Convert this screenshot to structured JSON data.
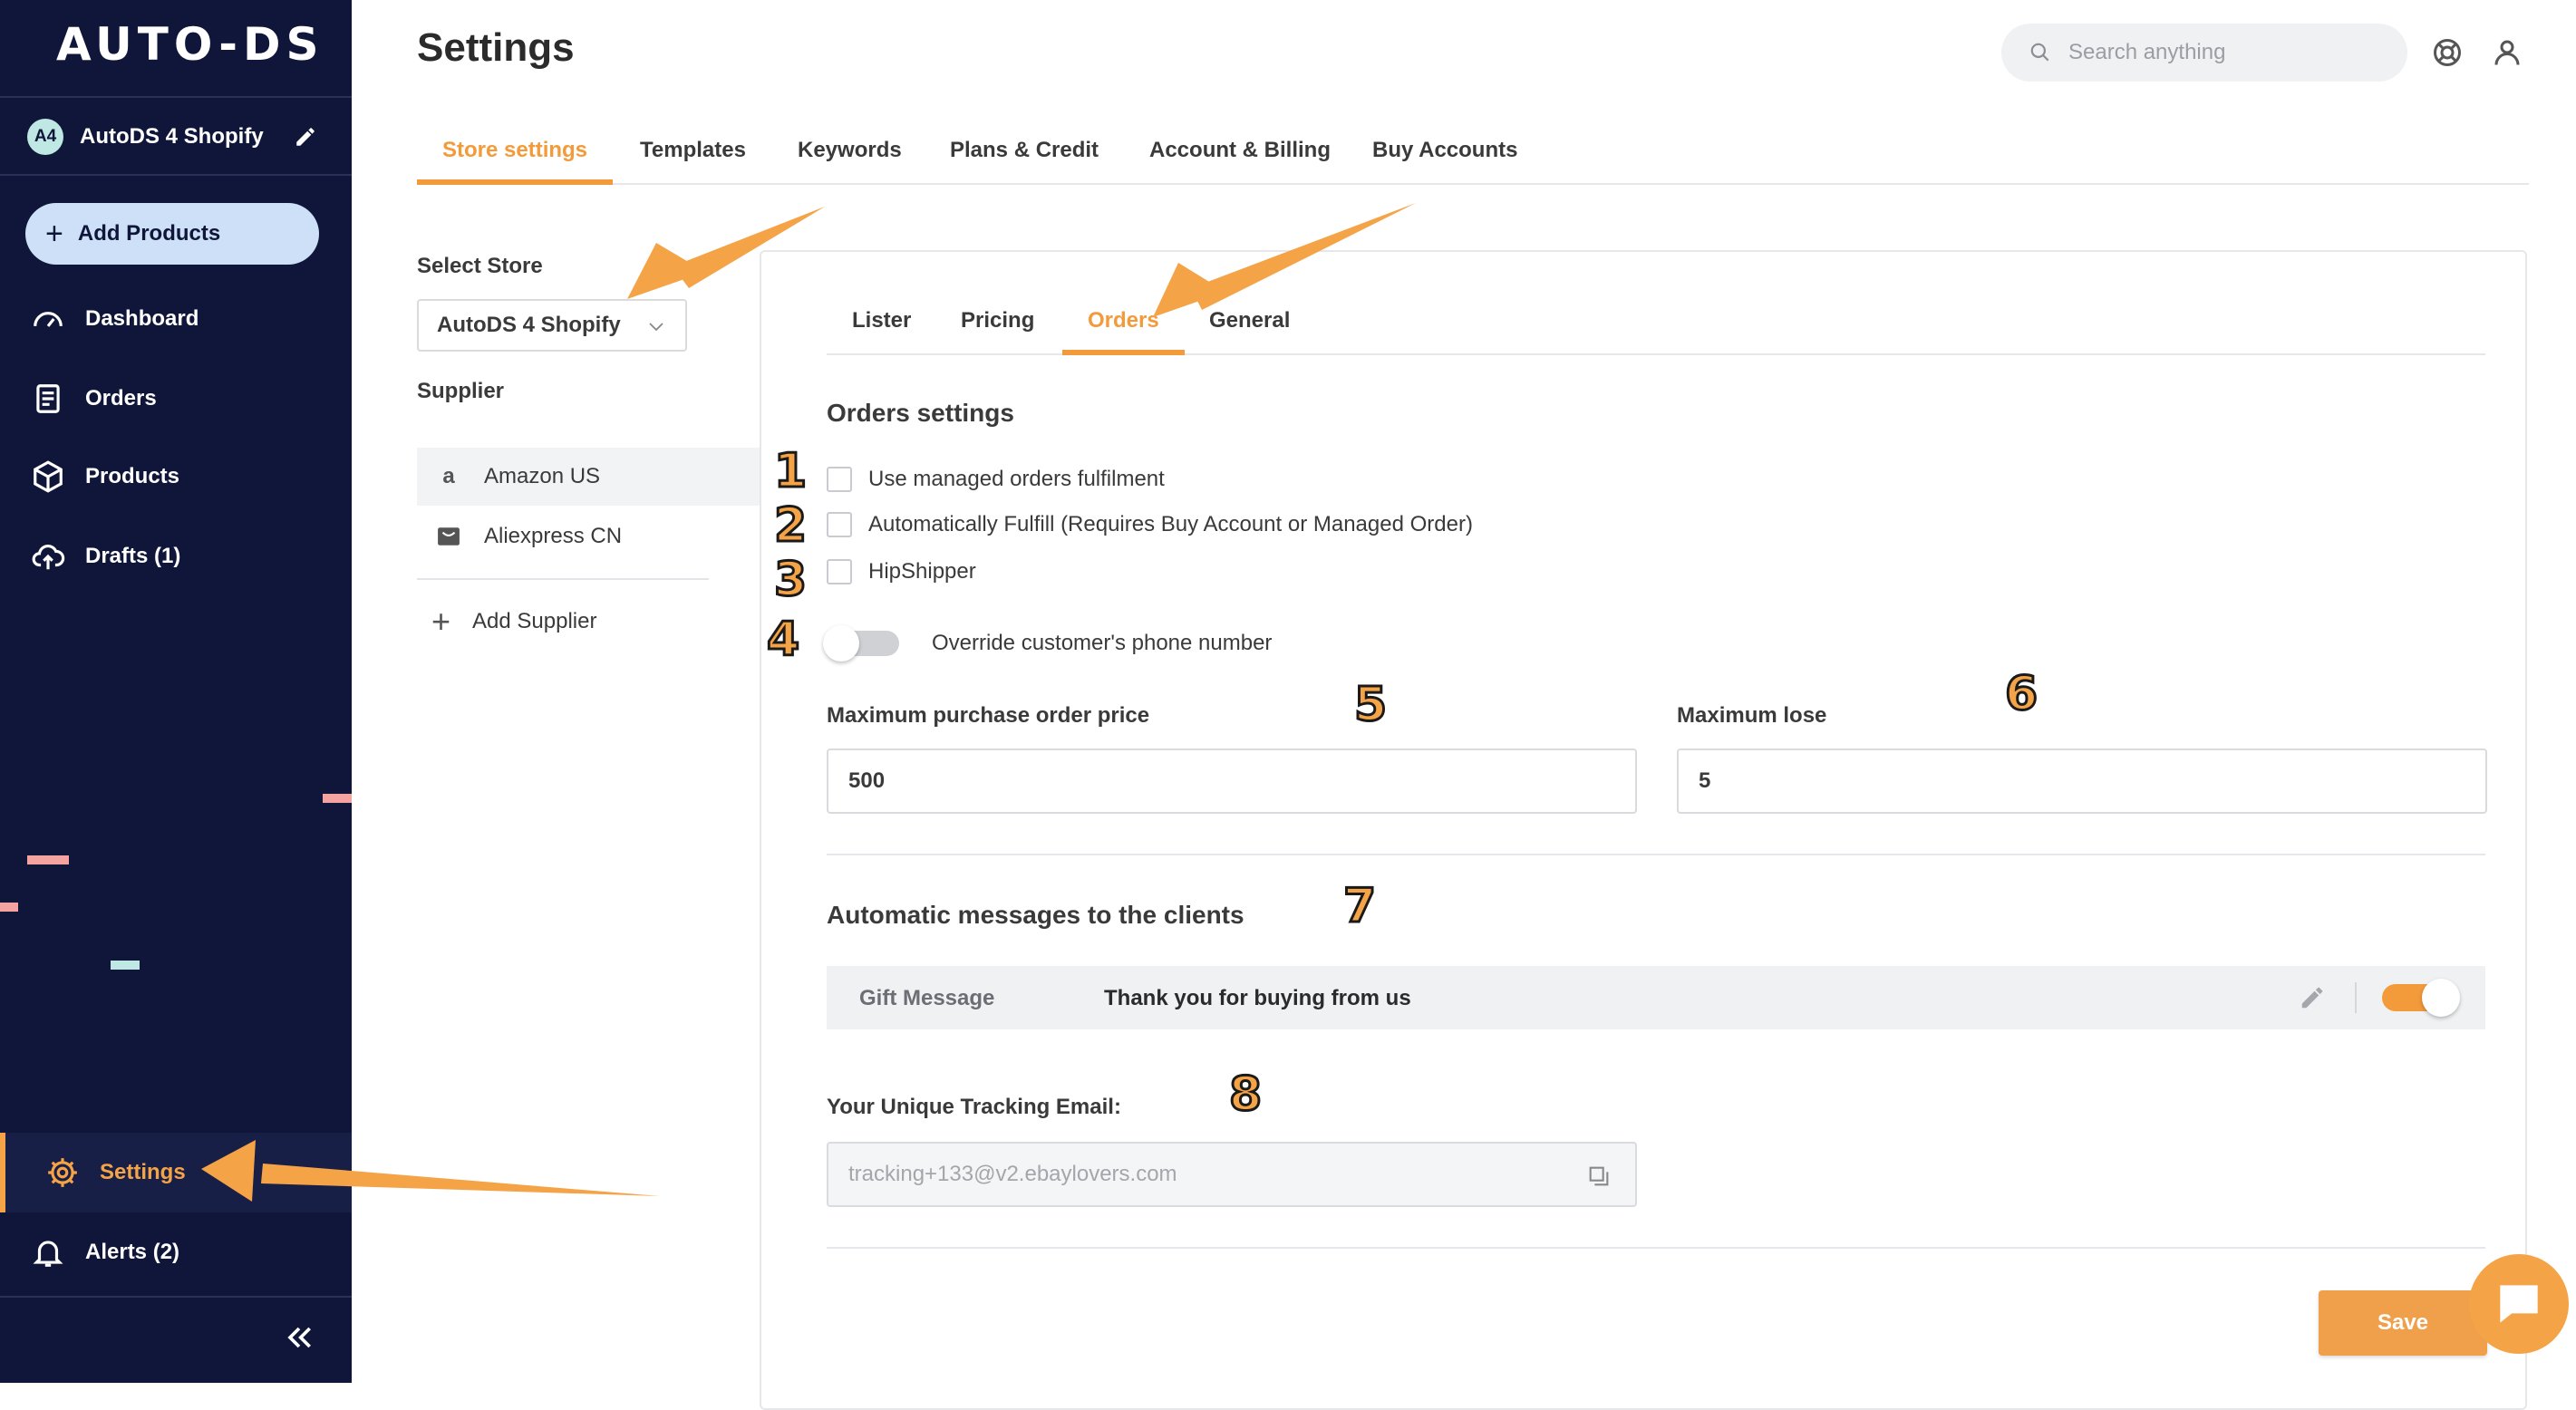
{
  "sidebar": {
    "logo": "AUTO-DS",
    "store_initials": "A4",
    "store_name": "AutoDS 4 Shopify",
    "add_products_label": "Add Products",
    "nav": {
      "dashboard": "Dashboard",
      "orders": "Orders",
      "products": "Products",
      "drafts": "Drafts (1)",
      "settings": "Settings",
      "alerts": "Alerts (2)"
    }
  },
  "header": {
    "title": "Settings",
    "search_placeholder": "Search anything"
  },
  "top_tabs": [
    "Store settings",
    "Templates",
    "Keywords",
    "Plans & Credit",
    "Account & Billing",
    "Buy Accounts"
  ],
  "store_panel": {
    "select_store_label": "Select Store",
    "selected_store": "AutoDS 4 Shopify",
    "supplier_label": "Supplier",
    "suppliers": [
      "Amazon US",
      "Aliexpress CN"
    ],
    "add_supplier_label": "Add Supplier"
  },
  "inner_tabs": [
    "Lister",
    "Pricing",
    "Orders",
    "General"
  ],
  "orders_settings": {
    "title": "Orders settings",
    "checkboxes": [
      "Use managed orders fulfilment",
      "Automatically Fulfill (Requires Buy Account or Managed Order)",
      "HipShipper"
    ],
    "toggle_label": "Override customer's phone number",
    "max_purchase_label": "Maximum purchase order price",
    "max_purchase_value": "500",
    "max_lose_label": "Maximum lose",
    "max_lose_value": "5"
  },
  "auto_messages": {
    "title": "Automatic messages to the clients",
    "gift_label": "Gift Message",
    "gift_text": "Thank you for buying from us",
    "gift_enabled": true
  },
  "tracking": {
    "label": "Your Unique Tracking Email:",
    "value": "tracking+133@v2.ebaylovers.com"
  },
  "save_label": "Save",
  "annotations": [
    "1",
    "2",
    "3",
    "4",
    "5",
    "6",
    "7",
    "8"
  ],
  "colors": {
    "sidebar_bg": "#10163a",
    "accent": "#f39a3b",
    "add_products_bg": "#cde0f7"
  }
}
